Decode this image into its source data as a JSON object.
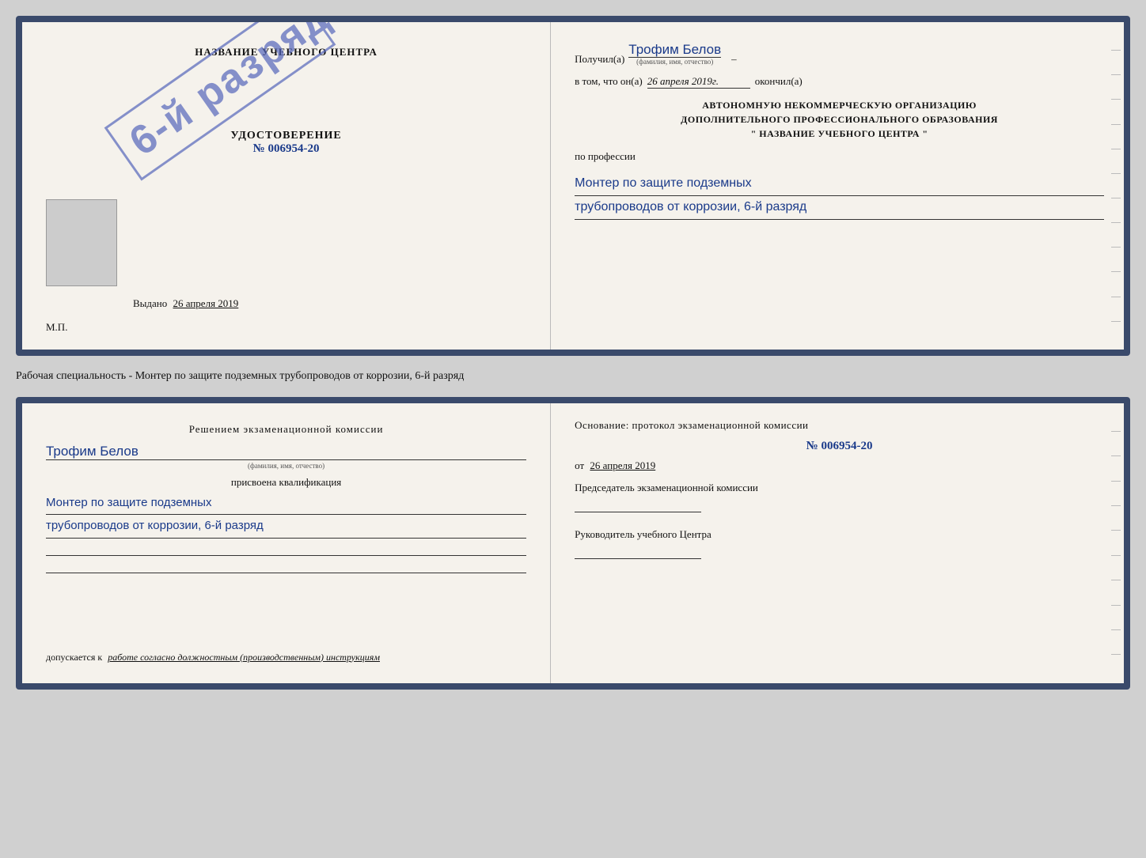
{
  "background_color": "#d0d0d0",
  "border_color": "#3a4a6b",
  "stamp_color": "#5566bb",
  "top_cert": {
    "left": {
      "school_title": "НАЗВАНИЕ УЧЕБНОГО ЦЕНТРА",
      "udost_label": "УДОСТОВЕРЕНИЕ",
      "udost_number": "№ 006954-20",
      "stamp_text": "6-й разряд",
      "vydano_label": "Выдано",
      "vydano_date": "26 апреля 2019",
      "mp_label": "М.П."
    },
    "right": {
      "poluchil_label": "Получил(а)",
      "poluchil_name": "Трофим Белов",
      "poluchil_subtitle": "(фамилия, имя, отчество)",
      "poluchil_dash": "–",
      "vtom_label": "в том, что он(а)",
      "vtom_date": "26 апреля 2019г.",
      "okochil_label": "окончил(а)",
      "org_line1": "АВТОНОМНУЮ НЕКОММЕРЧЕСКУЮ ОРГАНИЗАЦИЮ",
      "org_line2": "ДОПОЛНИТЕЛЬНОГО ПРОФЕССИОНАЛЬНОГО ОБРАЗОВАНИЯ",
      "org_line3": "\" НАЗВАНИЕ УЧЕБНОГО ЦЕНТРА \"",
      "po_professii": "по профессии",
      "profession_line1": "Монтер по защите подземных",
      "profession_line2": "трубопроводов от коррозии, 6-й разряд"
    }
  },
  "working_specialty": "Рабочая специальность - Монтер по защите подземных трубопроводов от коррозии, 6-й разряд",
  "bottom_cert": {
    "left": {
      "resheniem_text": "Решением экзаменационной комиссии",
      "name": "Трофим Белов",
      "name_subtitle": "(фамилия, имя, отчество)",
      "prisvoena_text": "присвоена квалификация",
      "qualification_line1": "Монтер по защите подземных",
      "qualification_line2": "трубопроводов от коррозии, 6-й разряд",
      "dopuskaetsya_label": "допускается к",
      "dopuskaetsya_value": "работе согласно должностным (производственным) инструкциям"
    },
    "right": {
      "osnovanie_text": "Основание: протокол экзаменационной комиссии",
      "protocol_number": "№ 006954-20",
      "ot_label": "от",
      "ot_date": "26 апреля 2019",
      "predsedatel_label": "Председатель экзаменационной комиссии",
      "rukovoditel_label": "Руководитель учебного Центра"
    }
  }
}
